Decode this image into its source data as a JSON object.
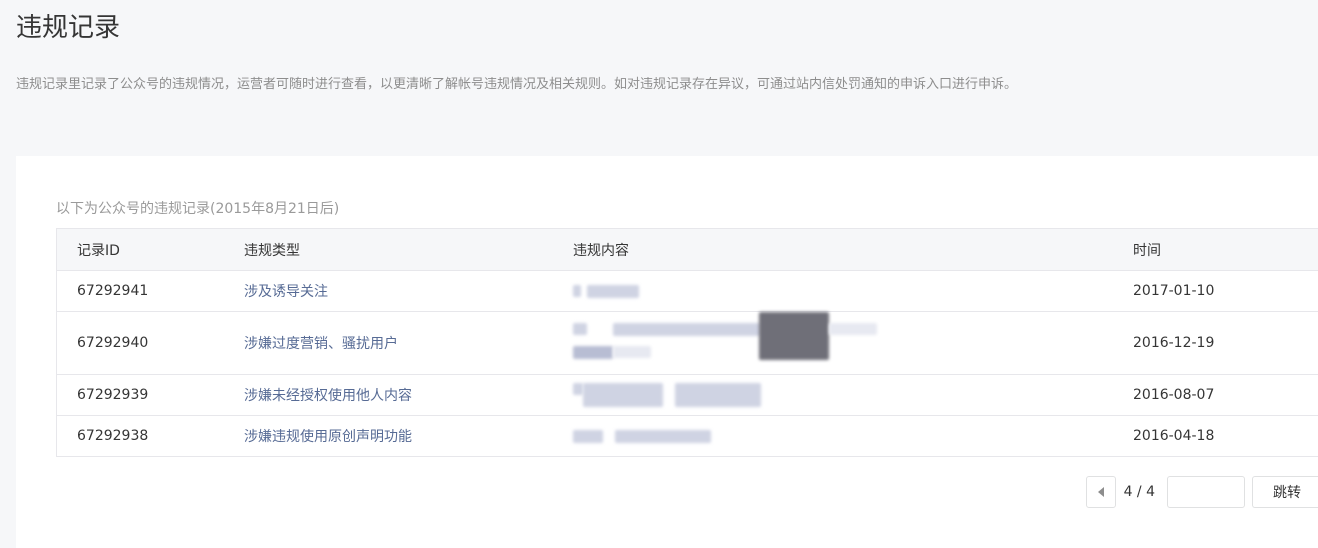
{
  "page": {
    "title": "违规记录",
    "description": "违规记录里记录了公众号的违规情况，运营者可随时进行查看，以更清晰了解帐号违规情况及相关规则。如对违规记录存在异议，可通过站内信处罚通知的申诉入口进行申诉。"
  },
  "records": {
    "note": "以下为公众号的违规记录(2015年8月21日后)",
    "headers": [
      "记录ID",
      "违规类型",
      "违规内容",
      "时间"
    ],
    "rows": [
      {
        "id": "67292941",
        "type": "涉及诱导关注",
        "time": "2017-01-10"
      },
      {
        "id": "67292940",
        "type": "涉嫌过度营销、骚扰用户",
        "time": "2016-12-19"
      },
      {
        "id": "67292939",
        "type": "涉嫌未经授权使用他人内容",
        "time": "2016-08-07"
      },
      {
        "id": "67292938",
        "type": "涉嫌违规使用原创声明功能",
        "time": "2016-04-18"
      }
    ]
  },
  "pagination": {
    "count": "4 / 4",
    "input_value": "",
    "jump_label": "跳转"
  }
}
